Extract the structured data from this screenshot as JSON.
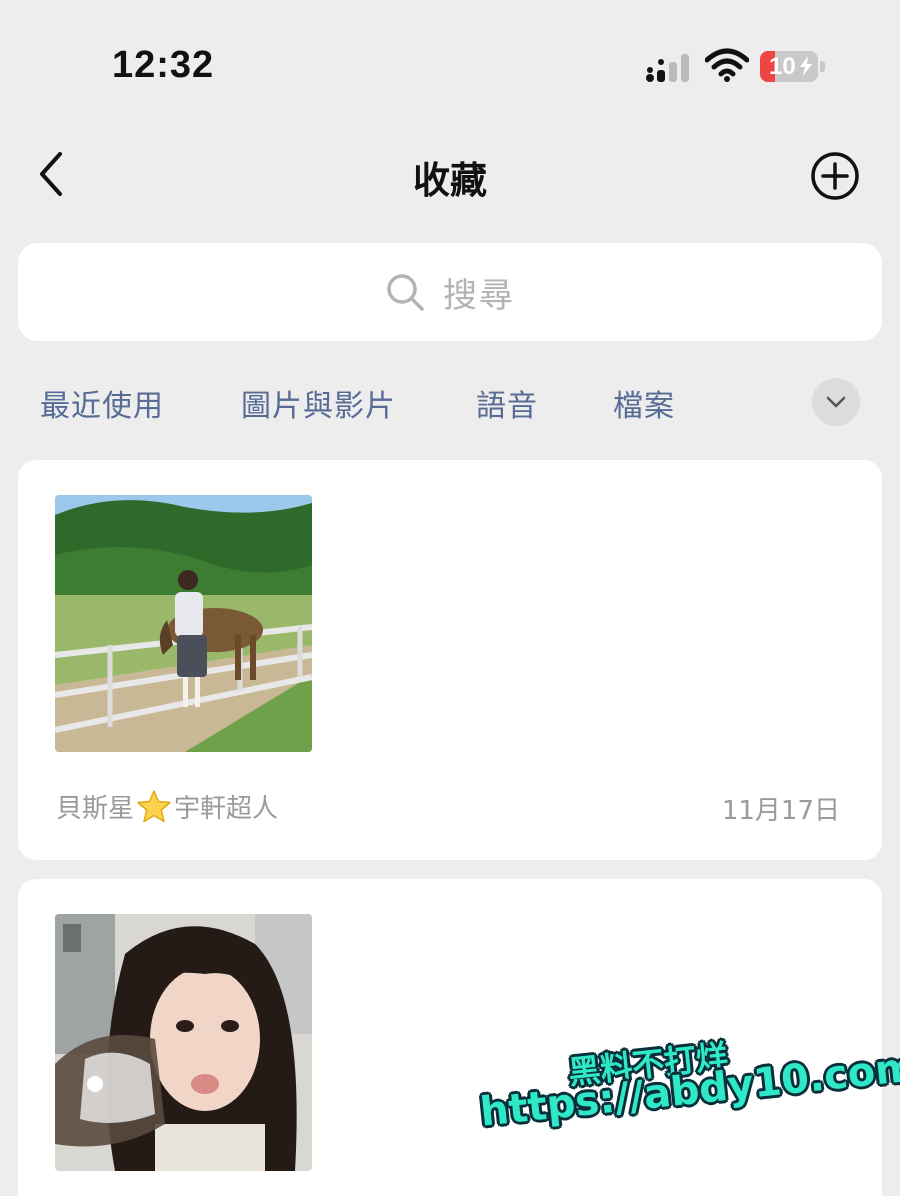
{
  "status_bar": {
    "time": "12:32",
    "battery_level": "10",
    "battery_percent": 10,
    "icons": [
      "signal-icon",
      "wifi-icon",
      "battery-charging-icon"
    ]
  },
  "nav": {
    "title": "收藏",
    "back_icon": "chevron-left-icon",
    "add_icon": "plus-circle-icon"
  },
  "search": {
    "placeholder": "搜尋",
    "icon": "search-icon"
  },
  "tabs": [
    {
      "label": "最近使用"
    },
    {
      "label": "圖片與影片"
    },
    {
      "label": "語音"
    },
    {
      "label": "檔案"
    }
  ],
  "tabs_expand_icon": "chevron-down-icon",
  "favorites": [
    {
      "thumbnail": "photo-girl-with-horse",
      "source_prefix": "貝斯星",
      "source_emoji": "star-icon",
      "source_suffix": "宇軒超人",
      "date": "11月17日"
    },
    {
      "thumbnail": "photo-girl-selfie",
      "source_prefix": "",
      "source_suffix": "",
      "date": ""
    }
  ],
  "watermark": {
    "line1": "黑料不打烊",
    "line2": "https://abdy10.com"
  },
  "colors": {
    "background": "#ededed",
    "tab_text": "#576b95",
    "meta_text": "#9a9a9a",
    "battery_low": "#ee4444",
    "watermark": "#2ee8c7"
  }
}
